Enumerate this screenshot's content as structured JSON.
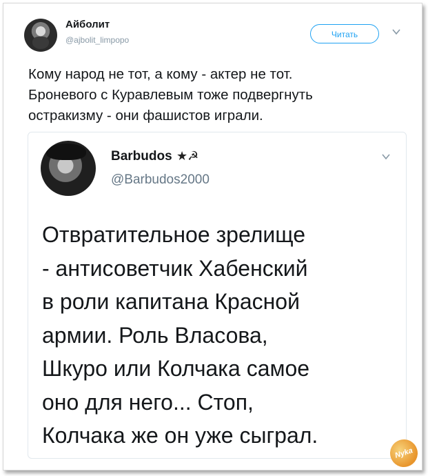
{
  "tweet": {
    "author_name": "Айболит",
    "author_handle": "@ajbolit_limpopo",
    "follow_label": "Читать",
    "text": "Кому народ не тот, а кому - актер не тот.\nБроневого с Куравлевым тоже подвергнуть\nостракизму - они фашистов играли."
  },
  "quoted_tweet": {
    "author_name": "Barbudos",
    "badge": "★☭",
    "author_handle": "@Barbudos2000",
    "text": "Отвратительное зрелище\n- антисоветчик Хабенский\nв роли капитана Красной\nармии. Роль Власова,\nШкуро или Колчака самое\nоно для него... Стоп,\nКолчака же он уже сыграл."
  },
  "watermark_text": "Nyka",
  "colors": {
    "accent": "#1da1f2",
    "text": "#14171a",
    "muted": "#8899a6",
    "border": "#e1e8ed"
  }
}
